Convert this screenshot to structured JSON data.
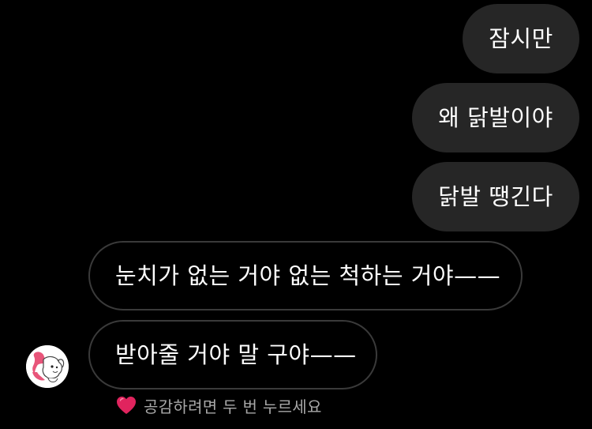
{
  "messages": [
    {
      "id": "b1",
      "direction": "outgoing",
      "text": "잠시만"
    },
    {
      "id": "b2",
      "direction": "outgoing",
      "text": "왜 닭발이야"
    },
    {
      "id": "b3",
      "direction": "outgoing",
      "text": "닭발 땡긴다"
    },
    {
      "id": "b4",
      "direction": "incoming",
      "text": "눈치가 없는 거야 없는 척하는 거야——"
    },
    {
      "id": "b5",
      "direction": "incoming",
      "text": "받아줄 거야 말 구야——"
    }
  ],
  "reaction_hint": {
    "icon": "heart-icon",
    "text": "공감하려면 두 번 누르세요"
  },
  "colors": {
    "background": "#000000",
    "outgoing_bubble": "#262626",
    "incoming_border": "#3a3a3a",
    "heart": "#e0245e",
    "hint_text": "#a8a8a8"
  }
}
